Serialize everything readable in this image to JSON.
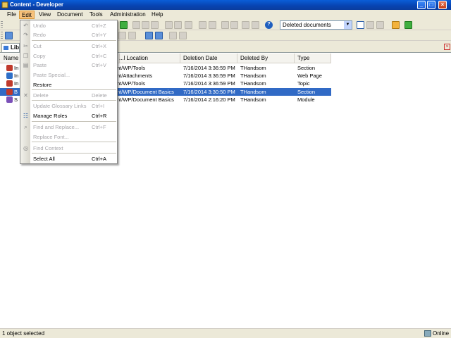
{
  "window": {
    "title": "Content - Developer"
  },
  "menubar": {
    "items": [
      {
        "label": "File"
      },
      {
        "label": "Edit"
      },
      {
        "label": "View"
      },
      {
        "label": "Document"
      },
      {
        "label": "Tools"
      },
      {
        "label": "Administration"
      },
      {
        "label": "Help"
      }
    ]
  },
  "toolbar": {
    "view_selector": "Deleted documents",
    "help_label": "?"
  },
  "library_tab": {
    "label": "Lib",
    "close_glyph": "×"
  },
  "table": {
    "columns": [
      "Name",
      "...l Location",
      "Deletion Date",
      "Deleted By",
      "Type"
    ],
    "rows": [
      {
        "name": "In",
        "location": "nt/WP/Tools",
        "date": "7/16/2014 3:36:59 PM",
        "by": "THandsom",
        "type": "Section",
        "icon_color": "#c0392b"
      },
      {
        "name": "In",
        "location": "nt/Attachments",
        "date": "7/16/2014 3:36:59 PM",
        "by": "THandsom",
        "type": "Web Page",
        "icon_color": "#2e6fc8"
      },
      {
        "name": "In",
        "location": "nt/WP/Tools",
        "date": "7/16/2014 3:36:59 PM",
        "by": "THandsom",
        "type": "Topic",
        "icon_color": "#c0392b"
      },
      {
        "name": "B",
        "location": "nt/WP/Document Basics",
        "date": "7/16/2014 3:30:50 PM",
        "by": "THandsom",
        "type": "Section",
        "icon_color": "#c0392b"
      },
      {
        "name": "S",
        "location": "nt/WP/Document Basics",
        "date": "7/16/2014 2:16:20 PM",
        "by": "THandsom",
        "type": "Module",
        "icon_color": "#7a4fb8"
      }
    ]
  },
  "edit_menu": {
    "items": [
      {
        "label": "Undo",
        "shortcut": "Ctrl+Z"
      },
      {
        "label": "Redo",
        "shortcut": "Ctrl+Y"
      },
      {
        "label": "Cut",
        "shortcut": "Ctrl+X"
      },
      {
        "label": "Copy",
        "shortcut": "Ctrl+C"
      },
      {
        "label": "Paste",
        "shortcut": "Ctrl+V"
      },
      {
        "label": "Paste Special...",
        "shortcut": ""
      },
      {
        "label": "Restore",
        "shortcut": ""
      },
      {
        "label": "Delete",
        "shortcut": "Delete"
      },
      {
        "label": "Update Glossary Links",
        "shortcut": "Ctrl+I"
      },
      {
        "label": "Manage Roles",
        "shortcut": "Ctrl+R"
      },
      {
        "label": "Find and Replace...",
        "shortcut": "Ctrl+F"
      },
      {
        "label": "Replace Font...",
        "shortcut": ""
      },
      {
        "label": "Find Context",
        "shortcut": ""
      },
      {
        "label": "Select All",
        "shortcut": "Ctrl+A"
      }
    ]
  },
  "status": {
    "left": "1 object selected",
    "right": "Online"
  },
  "colors": {
    "selection": "#316ac5",
    "menu_highlight": "#f7c27c",
    "titlebar": "#0a5ed8"
  }
}
